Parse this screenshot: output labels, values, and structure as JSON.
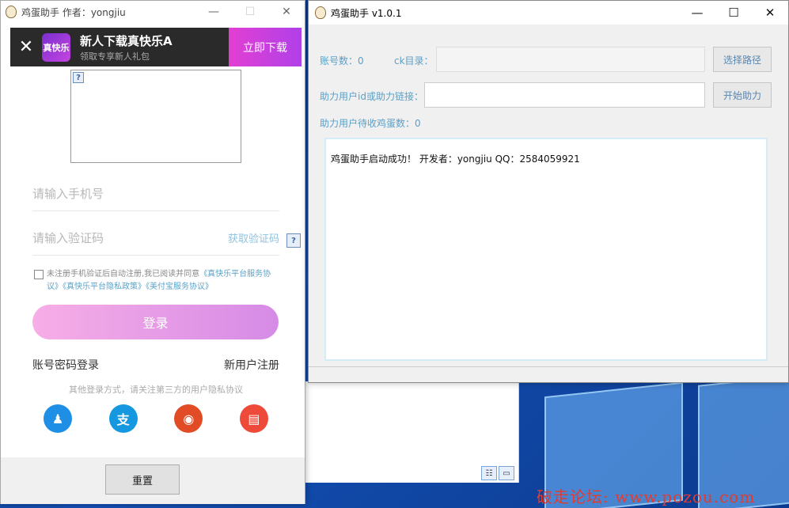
{
  "left_window": {
    "title": "鸡蛋助手 作者：yongjiu",
    "promo": {
      "close": "✕",
      "icon_text": "真快乐",
      "title": "新人下载真快乐A",
      "subtitle": "领取专享新人礼包",
      "button": "立即下载"
    },
    "captcha_q": "?",
    "phone_placeholder": "请输入手机号",
    "code_placeholder": "请输入验证码",
    "get_code": "获取验证码",
    "agree_prefix": "未注册手机验证后自动注册,我已阅读并同意",
    "agree_links": [
      "《真快乐平台服务协议》",
      "《真快乐平台隐私政策》",
      "《美付宝服务协议》"
    ],
    "login_button": "登录",
    "password_login": "账号密码登录",
    "register": "新用户注册",
    "other_tip": "其他登录方式，请关注第三方的用户隐私协议",
    "reset_button": "重置",
    "social_icons": [
      "qq-icon",
      "alipay-icon",
      "weibo-icon",
      "card-icon"
    ]
  },
  "right_window": {
    "title": "鸡蛋助手 v1.0.1",
    "account_count_label": "账号数：0",
    "ck_dir_label": "ck目录：",
    "choose_path_button": "选择路径",
    "help_id_label": "助力用户id或助力链接：",
    "start_help_button": "开始助力",
    "pending_eggs_label": "助力用户待收鸡蛋数：0",
    "log_text": "鸡蛋助手启动成功！ 开发者：yongjiu QQ：2584059921"
  },
  "watermark": "破走论坛: www.pozou.com",
  "colors": {
    "accent_label": "#5ba0c8",
    "promo_button": "#c43fe0",
    "login_gradient_start": "#f7aee6",
    "watermark": "#e33b2e"
  }
}
